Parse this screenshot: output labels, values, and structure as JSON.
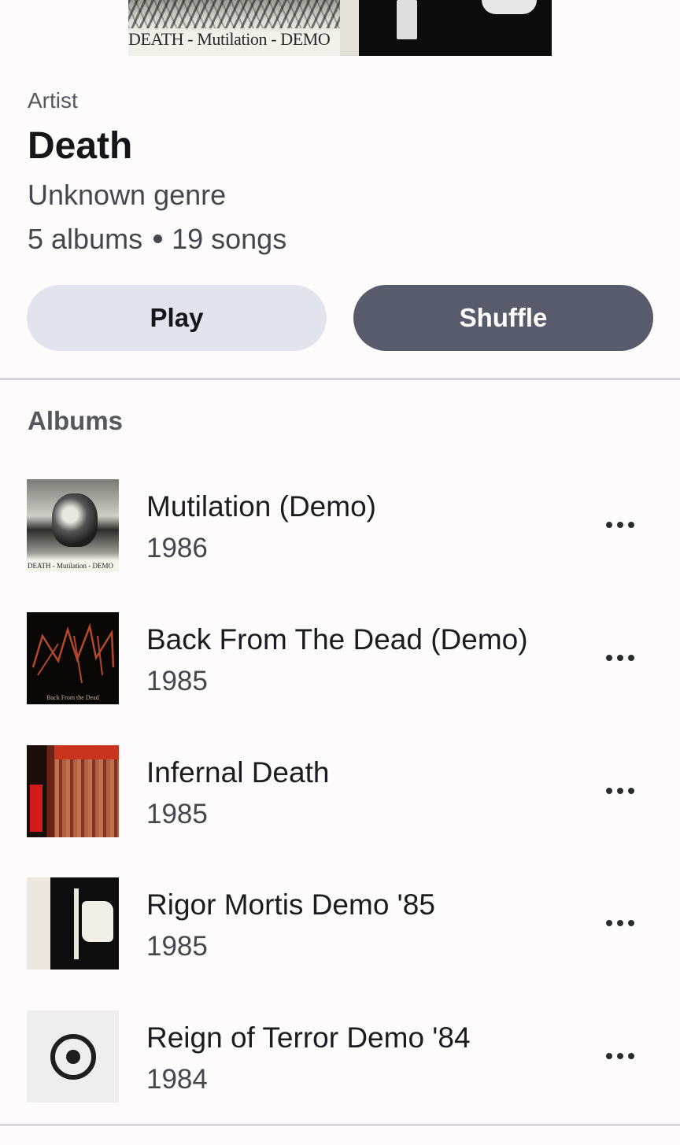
{
  "hero": {
    "caption": "DEATH - Mutilation - DEMO"
  },
  "artist": {
    "label": "Artist",
    "name": "Death",
    "genre": "Unknown genre",
    "albums_count": "5 albums",
    "songs_count": "19 songs"
  },
  "actions": {
    "play_label": "Play",
    "shuffle_label": "Shuffle"
  },
  "albums_section": {
    "title": "Albums",
    "items": [
      {
        "title": "Mutilation (Demo)",
        "year": "1986",
        "art": "mutilation-cover",
        "art_caption": "DEATH - Mutilation - DEMO"
      },
      {
        "title": "Back From The Dead (Demo)",
        "year": "1985",
        "art": "back-from-the-dead-cover",
        "art_caption": "Back From the Dead"
      },
      {
        "title": "Infernal Death",
        "year": "1985",
        "art": "infernal-death-cover"
      },
      {
        "title": "Rigor Mortis Demo '85",
        "year": "1985",
        "art": "rigor-mortis-cover"
      },
      {
        "title": "Reign of Terror Demo '84",
        "year": "1984",
        "art": "placeholder-disc-icon"
      }
    ]
  },
  "icons": {
    "more": "more-horizontal-icon",
    "placeholder": "disc-icon"
  }
}
